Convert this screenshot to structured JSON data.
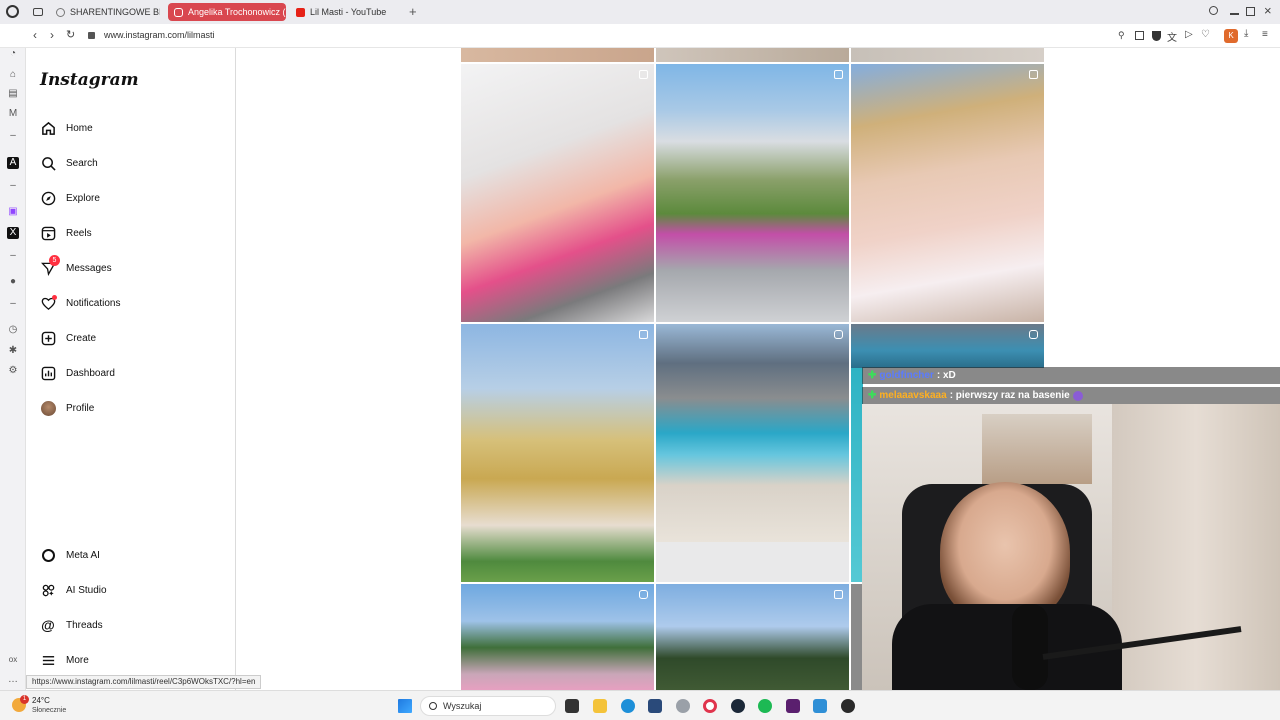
{
  "tabs": [
    {
      "label": "SHARENTINGOWE BINGO",
      "active": false
    },
    {
      "label": "Angelika Trochonowicz (",
      "active": true
    },
    {
      "label": "Lil Masti - YouTube",
      "active": false
    }
  ],
  "address_bar": {
    "url": "www.instagram.com/lilmasti"
  },
  "instagram": {
    "logo": "Instagram",
    "nav": [
      {
        "label": "Home",
        "icon": "home-icon"
      },
      {
        "label": "Search",
        "icon": "search-icon"
      },
      {
        "label": "Explore",
        "icon": "compass-icon"
      },
      {
        "label": "Reels",
        "icon": "reels-icon"
      },
      {
        "label": "Messages",
        "icon": "messenger-icon",
        "badge": "5"
      },
      {
        "label": "Notifications",
        "icon": "heart-icon"
      },
      {
        "label": "Create",
        "icon": "plus-square-icon"
      },
      {
        "label": "Dashboard",
        "icon": "dashboard-icon"
      },
      {
        "label": "Profile",
        "icon": "avatar-icon"
      }
    ],
    "bottom_nav": [
      {
        "label": "Meta AI",
        "icon": "meta-ai-icon"
      },
      {
        "label": "AI Studio",
        "icon": "ai-studio-icon"
      },
      {
        "label": "Threads",
        "icon": "threads-icon"
      },
      {
        "label": "More",
        "icon": "menu-icon"
      }
    ]
  },
  "chat": [
    {
      "user": "goldfincher",
      "message": ": xD",
      "color": "#4a6cff"
    },
    {
      "user": "melaaavskaaa",
      "message": ": pierwszy raz na basenie",
      "color": "#ffb020"
    }
  ],
  "status_link": "https://www.instagram.com/lilmasti/reel/C3p6WOksTXC/?hl=en",
  "taskbar": {
    "weather_temp": "24°C",
    "weather_desc": "Słonecznie",
    "weather_badge": "1",
    "search_placeholder": "Wyszukaj"
  },
  "colors": {
    "accent_tab": "#d9474f",
    "badge": "#ff3040"
  }
}
